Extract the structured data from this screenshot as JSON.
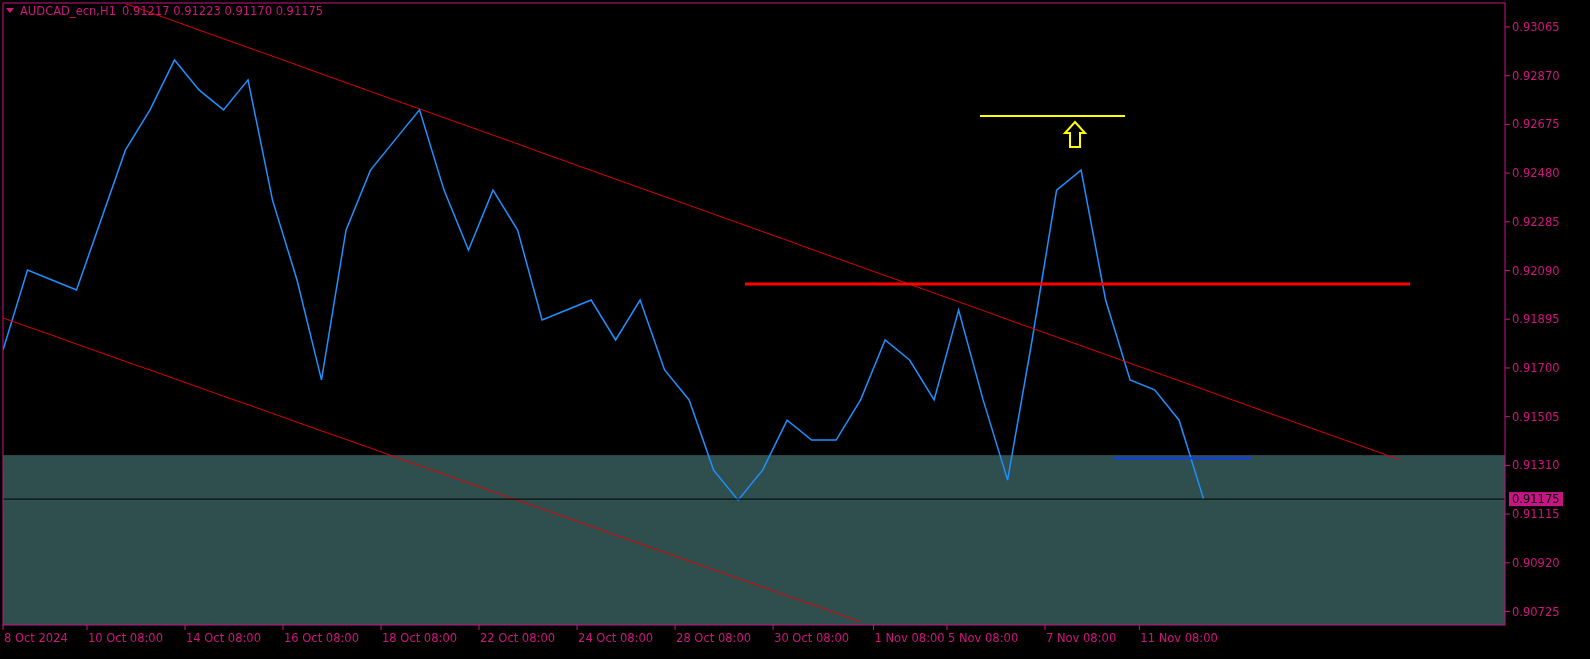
{
  "header": {
    "symbol": "AUDCAD_ecn,H1",
    "ohlc": "0.91217 0.91223 0.91170 0.91175"
  },
  "current_price": "0.91175",
  "chart_data": {
    "type": "line",
    "ylim": [
      0.90671,
      0.93161
    ],
    "categories": [
      null,
      "8 Oct 2024",
      null,
      null,
      null,
      "10 Oct 08:00",
      null,
      null,
      null,
      "14 Oct 08:00",
      null,
      null,
      null,
      "16 Oct 08:00",
      null,
      null,
      null,
      "18 Oct 08:00",
      null,
      null,
      null,
      "22 Oct 08:00",
      null,
      null,
      null,
      "24 Oct 08:00",
      null,
      null,
      null,
      "28 Oct 08:00",
      null,
      null,
      null,
      "30 Oct 08:00",
      null,
      null,
      null,
      "1 Nov 08:00",
      null,
      null,
      "5 Nov 08:00",
      null,
      null,
      null,
      "7 Nov 08:00",
      null,
      null,
      null,
      "11 Nov 08:00",
      null,
      null,
      null,
      null,
      null,
      null,
      null,
      null,
      null
    ],
    "series": [
      {
        "color": "#1e90ff",
        "values": [
          0.91772,
          0.92092,
          0.92052,
          0.92012,
          0.92292,
          0.92573,
          0.92733,
          0.92933,
          0.92813,
          0.92733,
          0.92853,
          0.92372,
          0.92052,
          0.91652,
          0.92252,
          0.92492,
          0.92613,
          0.92733,
          0.92412,
          0.92172,
          0.92412,
          0.92252,
          0.91892,
          0.91932,
          0.91972,
          0.91812,
          0.91972,
          0.91692,
          0.91572,
          0.91291,
          0.91171,
          0.91291,
          0.91491,
          0.91411,
          0.91411,
          0.91572,
          0.91812,
          0.91732,
          0.91572,
          0.91932,
          0.91572,
          0.91251,
          0.91812,
          0.92412,
          0.92492,
          0.91972,
          0.91652,
          0.91612,
          0.91491,
          0.91175,
          null,
          null,
          null,
          null,
          null,
          null,
          null,
          null
        ]
      },
      {
        "color": "#e00000",
        "values": [
          null,
          null,
          null,
          null,
          null,
          0.93158,
          0.93123,
          0.93088,
          0.93053,
          0.93018,
          0.92983,
          0.92948,
          0.92913,
          0.92877,
          0.92842,
          0.92807,
          0.92772,
          0.92737,
          0.92702,
          0.92667,
          0.92632,
          0.92597,
          0.92561,
          0.92526,
          0.92491,
          0.92456,
          0.92421,
          0.92386,
          0.92351,
          0.92316,
          0.92281,
          0.92246,
          0.92211,
          0.92175,
          0.9214,
          0.92105,
          0.9207,
          0.92035,
          0.92,
          0.91965,
          0.9193,
          0.91894,
          0.91859,
          0.91824,
          0.91789,
          0.91754,
          0.91719,
          0.91684,
          0.91649,
          0.91614,
          0.91578,
          0.91543,
          0.91508,
          0.91473,
          0.91438,
          0.91403,
          0.91368,
          0.91333
        ]
      },
      {
        "color": "#e00000",
        "values": [
          0.919,
          0.91865,
          0.91831,
          0.91796,
          0.91761,
          0.91726,
          0.91692,
          0.91657,
          0.91622,
          0.91587,
          0.91553,
          0.91518,
          0.91483,
          0.91448,
          0.91414,
          0.91379,
          0.91344,
          0.91309,
          0.91275,
          0.9124,
          0.91205,
          0.9117,
          0.91136,
          0.91101,
          0.91066,
          0.91031,
          0.90997,
          0.90962,
          0.90927,
          0.90892,
          0.90858,
          0.90823,
          0.90788,
          0.90753,
          0.90719,
          0.90684,
          null,
          null,
          null,
          null,
          null,
          null,
          null,
          null,
          null,
          null,
          null,
          null,
          null,
          null,
          null,
          null,
          null,
          null,
          null,
          null,
          null,
          null
        ]
      }
    ],
    "yticks": [
      {
        "value": 0.93065,
        "label": "0.93065"
      },
      {
        "value": 0.9287,
        "label": "0.92870"
      },
      {
        "value": 0.92675,
        "label": "0.92675"
      },
      {
        "value": 0.9248,
        "label": "0.92480"
      },
      {
        "value": 0.92285,
        "label": "0.92285"
      },
      {
        "value": 0.9209,
        "label": "0.92090"
      },
      {
        "value": 0.91895,
        "label": "0.91895"
      },
      {
        "value": 0.917,
        "label": "0.91700"
      },
      {
        "value": 0.91505,
        "label": "0.91505"
      },
      {
        "value": 0.9131,
        "label": "0.91310"
      },
      {
        "value": 0.91115,
        "label": "0.91115"
      },
      {
        "value": 0.9092,
        "label": "0.90920"
      },
      {
        "value": 0.90725,
        "label": "0.90725"
      }
    ],
    "bands": [
      {
        "axis": "y",
        "from": 0.90671,
        "to": 0.91351,
        "color": "#2f4f4f"
      }
    ],
    "ref_lines": [
      {
        "axis": "y",
        "value": 0.92036,
        "color": "#ff0000"
      },
      {
        "axis": "y",
        "value": 0.92709,
        "color": "#ffff00"
      },
      {
        "axis": "y",
        "value": 0.91339,
        "color": "#0a3cff"
      },
      {
        "axis": "y",
        "value": 0.91175,
        "color": "#000000"
      }
    ]
  }
}
